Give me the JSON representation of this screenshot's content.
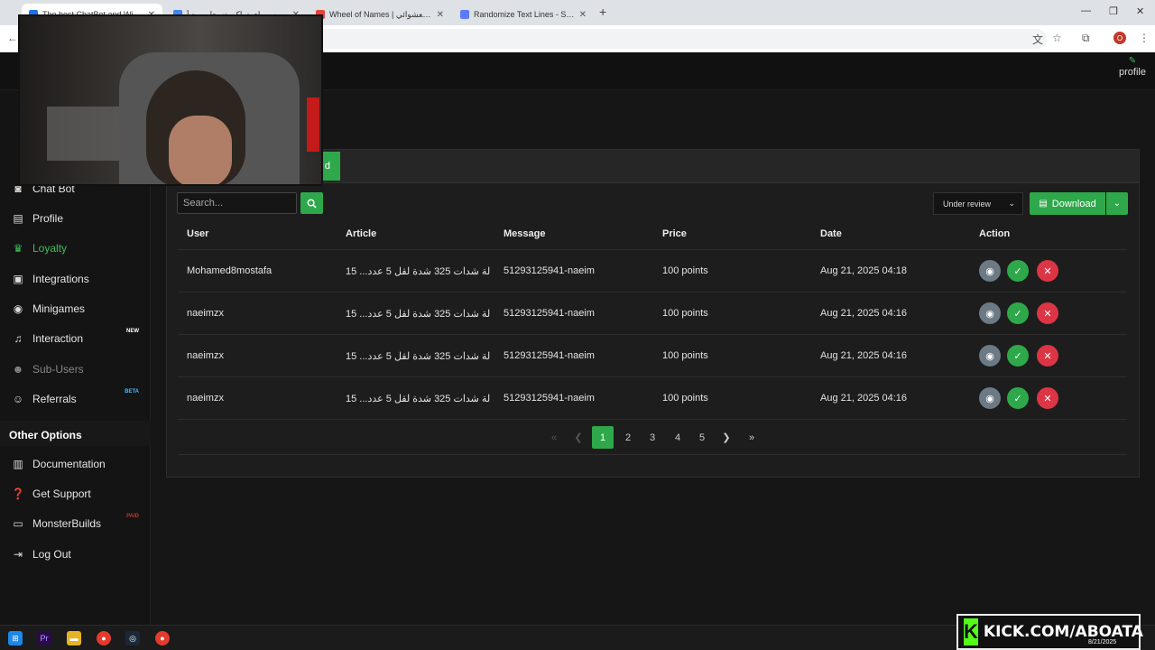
{
  "browser": {
    "tabs": [
      {
        "title": "The best ChatBot and Widget",
        "color": "#1a73e8"
      },
      {
        "title": "مدارس راي تماكو بتسحاب مع أ",
        "color": "#4285f4"
      },
      {
        "title": "Wheel of Names | اسم العشوائي",
        "color": "#ea4335"
      },
      {
        "title": "Randomize Text Lines - String",
        "color": "#5c7cfa"
      }
    ],
    "new_tab": "+",
    "account_initial": "O"
  },
  "topbar": {
    "profile_label": "profile"
  },
  "sidebar": {
    "items": [
      {
        "label": "Chat Bot",
        "icon": "robot-icon"
      },
      {
        "label": "Profile",
        "icon": "id-card-icon"
      },
      {
        "label": "Loyalty",
        "icon": "trophy-icon"
      },
      {
        "label": "Integrations",
        "icon": "chat-square-icon"
      },
      {
        "label": "Minigames",
        "icon": "gamepad-icon"
      },
      {
        "label": "Interaction",
        "icon": "music-note-icon",
        "badge": "NEW"
      },
      {
        "label": "Sub-Users",
        "icon": "users-icon"
      },
      {
        "label": "Referrals",
        "icon": "user-group-icon",
        "badge": "BETA"
      }
    ],
    "other_title": "Other Options",
    "other_items": [
      {
        "label": "Documentation",
        "icon": "book-icon"
      },
      {
        "label": "Get Support",
        "icon": "help-circle-icon"
      },
      {
        "label": "MonsterBuilds",
        "icon": "laptop-icon",
        "badge": "PAID"
      },
      {
        "label": "Log Out",
        "icon": "logout-icon"
      }
    ]
  },
  "toolbar": {
    "search_placeholder": "Search...",
    "status_value": "Under review",
    "download_label": "Download",
    "head_button_partial": "d"
  },
  "table": {
    "columns": [
      "User",
      "Article",
      "Message",
      "Price",
      "Date",
      "Action"
    ],
    "rows": [
      {
        "user": "Mohamed8mostafa",
        "article": "15 ...لة شدات 325 شدة لقل 5 عدد",
        "message": "51293125941-naeim",
        "price": "100 points",
        "date": "Aug 21, 2025 04:18"
      },
      {
        "user": "naeimzx",
        "article": "15 ...لة شدات 325 شدة لقل 5 عدد",
        "message": "51293125941-naeim",
        "price": "100 points",
        "date": "Aug 21, 2025 04:16"
      },
      {
        "user": "naeimzx",
        "article": "15 ...لة شدات 325 شدة لقل 5 عدد",
        "message": "51293125941-naeim",
        "price": "100 points",
        "date": "Aug 21, 2025 04:16"
      },
      {
        "user": "naeimzx",
        "article": "15 ...لة شدات 325 شدة لقل 5 عدد",
        "message": "51293125941-naeim",
        "price": "100 points",
        "date": "Aug 21, 2025 04:16"
      }
    ]
  },
  "pagination": {
    "pages": [
      "1",
      "2",
      "3",
      "4",
      "5"
    ],
    "current": "1"
  },
  "overlay": {
    "kick_letter": "K",
    "kick_text": "KICK.COM/ABOATA"
  },
  "taskbar": {
    "clock_date": "8/21/2025"
  }
}
